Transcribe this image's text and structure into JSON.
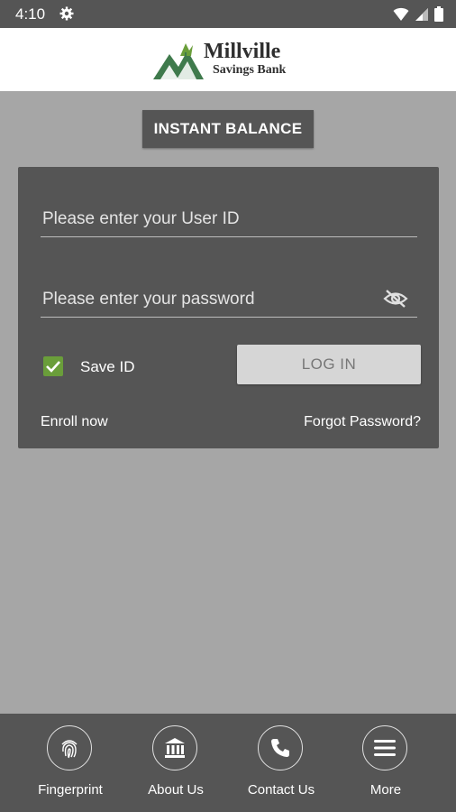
{
  "status_bar": {
    "time": "4:10"
  },
  "header": {
    "logo_name": "Millville",
    "logo_subtitle": "Savings Bank"
  },
  "instant_balance_label": "INSTANT BALANCE",
  "login": {
    "user_id_placeholder": "Please enter your User ID",
    "user_id_value": "",
    "password_placeholder": "Please enter your password",
    "password_value": "",
    "save_id_label": "Save ID",
    "save_id_checked": true,
    "login_button_label": "LOG IN",
    "enroll_label": "Enroll now",
    "forgot_label": "Forgot Password?"
  },
  "bottom_nav": {
    "items": [
      {
        "label": "Fingerprint",
        "icon": "fingerprint-icon"
      },
      {
        "label": "About Us",
        "icon": "bank-icon"
      },
      {
        "label": "Contact Us",
        "icon": "phone-icon"
      },
      {
        "label": "More",
        "icon": "menu-icon"
      }
    ]
  },
  "colors": {
    "background": "#a6a6a6",
    "panel": "#555555",
    "checkbox_accent": "#6a9e3a",
    "logo_green": "#3f7a4c"
  }
}
